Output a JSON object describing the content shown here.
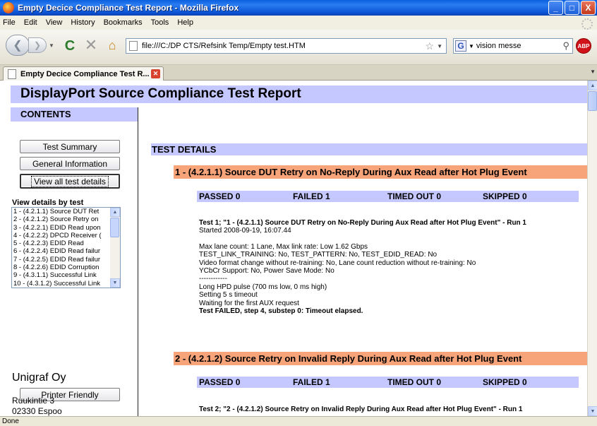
{
  "window": {
    "title": "Empty Decice Compliance Test Report - Mozilla Firefox",
    "buttons": {
      "minimize": "_",
      "maximize": "□",
      "close": "X"
    }
  },
  "menu": [
    {
      "label": "File"
    },
    {
      "label": "Edit"
    },
    {
      "label": "View"
    },
    {
      "label": "History"
    },
    {
      "label": "Bookmarks"
    },
    {
      "label": "Tools"
    },
    {
      "label": "Help"
    }
  ],
  "toolbar": {
    "url": "file:///C:/DP CTS/Refsink Temp/Empty test.HTM",
    "search_query": "vision messe",
    "search_engine_letter": "G",
    "adblock_label": "ABP"
  },
  "tab": {
    "label": "Empty Decice Compliance Test R..."
  },
  "report": {
    "heading": "DisplayPort Source Compliance Test Report",
    "contents_heading": "CONTENTS",
    "buttons": {
      "summary": "Test Summary",
      "general": "General Information",
      "view_all": "View all test details",
      "printer": "Printer Friendly"
    },
    "view_details_label": "View details by test",
    "test_list": [
      "1 - (4.2.1.1) Source DUT Ret",
      "2 - (4.2.1.2) Source Retry on",
      "3 - (4.2.2.1) EDID Read upon",
      "4 - (4.2.2.2) DPCD Receiver (",
      "5 - (4.2.2.3) EDID Read",
      "6 - (4.2.2.4) EDID Read failur",
      "7 - (4.2.2.5) EDID Read failur",
      "8 - (4.2.2.6) EDID Corruption",
      "9 - (4.3.1.1) Successful Link",
      "10 - (4.3.1.2) Successful Link"
    ],
    "company": "Unigraf Oy",
    "address_line1": "Ruukintie 3",
    "address_line2": "02330 Espoo",
    "test_details_heading": "TEST DETAILS",
    "tests": [
      {
        "title": "1 - (4.2.1.1) Source DUT Retry on No-Reply During Aux Read after Hot Plug Event",
        "passed": "PASSED 0",
        "failed": "FAILED 1",
        "timed_out": "TIMED OUT 0",
        "skipped": "SKIPPED 0",
        "run_header": "Test 1; \"1 - (4.2.1.1) Source DUT Retry on No-Reply During Aux Read after Hot Plug Event\" - Run 1",
        "started": "Started 2008-09-19, 16:07.44",
        "lines": [
          "Max lane count: 1 Lane, Max link rate: Low 1.62 Gbps",
          "TEST_LINK_TRAINING: No, TEST_PATTERN: No, TEST_EDID_READ: No",
          "Video format change without re-training: No, Lane count reduction without re-training: No",
          "YCbCr Support: No, Power Save Mode: No",
          "------------",
          "Long HPD pulse (700 ms low, 0 ms high)",
          "Setting 5 s timeout",
          "Waiting for the first AUX request"
        ],
        "result": "Test FAILED, step 4, substep 0: Timeout elapsed."
      },
      {
        "title": "2 - (4.2.1.2) Source Retry on Invalid Reply During Aux Read after Hot Plug Event",
        "passed": "PASSED 0",
        "failed": "FAILED 1",
        "timed_out": "TIMED OUT 0",
        "skipped": "SKIPPED 0",
        "run_header": "Test 2; \"2 - (4.2.1.2) Source Retry on Invalid Reply During Aux Read after Hot Plug Event\" - Run 1"
      }
    ]
  },
  "status": {
    "text": "Done"
  }
}
